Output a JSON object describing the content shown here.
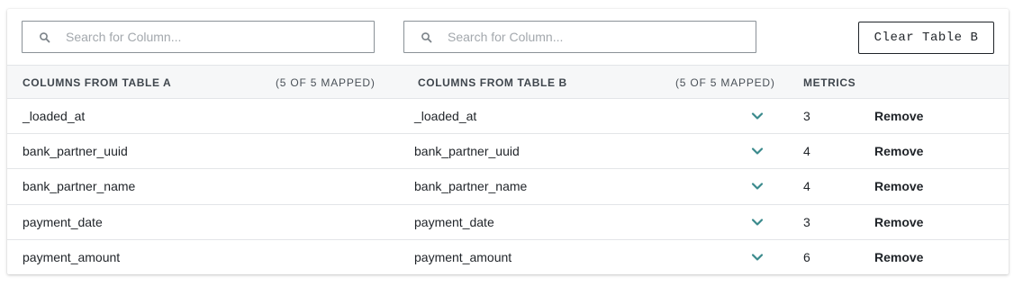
{
  "search": {
    "a_placeholder": "Search for Column...",
    "b_placeholder": "Search for Column..."
  },
  "toolbar": {
    "clear_label": "Clear Table B"
  },
  "header": {
    "col_a": "COLUMNS FROM TABLE A",
    "col_a_mapped": "(5 OF 5 MAPPED)",
    "col_b": "COLUMNS FROM TABLE B",
    "col_b_mapped": "(5 OF 5 MAPPED)",
    "metrics": "METRICS"
  },
  "rows": [
    {
      "a": "_loaded_at",
      "b": "_loaded_at",
      "metrics": "3",
      "action": "Remove"
    },
    {
      "a": "bank_partner_uuid",
      "b": "bank_partner_uuid",
      "metrics": "4",
      "action": "Remove"
    },
    {
      "a": "bank_partner_name",
      "b": "bank_partner_name",
      "metrics": "4",
      "action": "Remove"
    },
    {
      "a": "payment_date",
      "b": "payment_date",
      "metrics": "3",
      "action": "Remove"
    },
    {
      "a": "payment_amount",
      "b": "payment_amount",
      "metrics": "6",
      "action": "Remove"
    }
  ],
  "colors": {
    "chevron": "#3a8a8c",
    "border": "#8a9197",
    "header_bg": "#f6f7f8"
  },
  "icons": {
    "search": "search-icon",
    "chevron": "chevron-down-icon"
  }
}
